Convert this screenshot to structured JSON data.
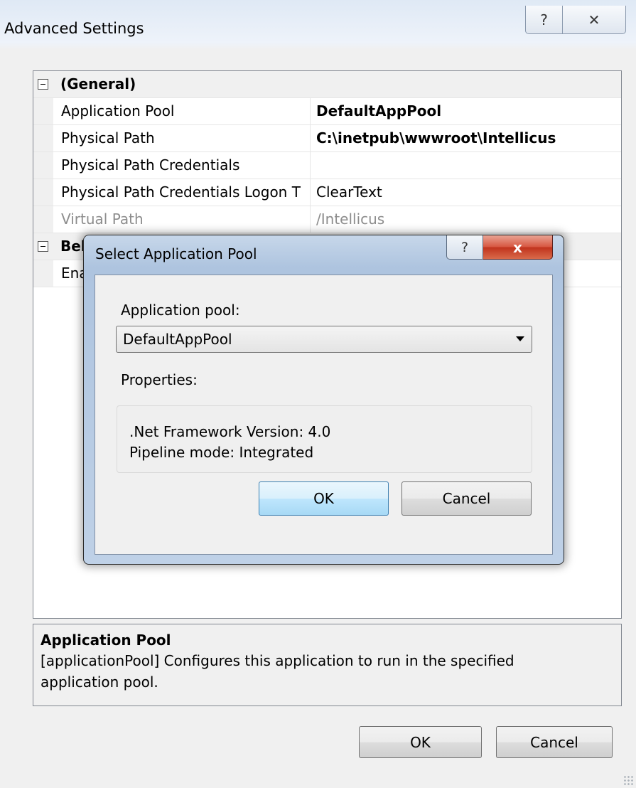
{
  "window": {
    "title": "Advanced Settings",
    "help_glyph": "?",
    "close_glyph": "✕"
  },
  "grid": {
    "general_category": "(General)",
    "behavior_category_partial": "Bel",
    "behavior_row_partial": "Ena",
    "rows": [
      {
        "label": "Application Pool",
        "value": "DefaultAppPool"
      },
      {
        "label": "Physical Path",
        "value": "C:\\inetpub\\wwwroot\\Intellicus"
      },
      {
        "label": "Physical Path Credentials",
        "value": ""
      },
      {
        "label": "Physical Path Credentials Logon T",
        "value": "ClearText"
      },
      {
        "label": "Virtual Path",
        "value": "/Intellicus"
      }
    ]
  },
  "description": {
    "title": "Application Pool",
    "text": "[applicationPool] Configures this application to run in the specified application pool."
  },
  "buttons": {
    "ok": "OK",
    "cancel": "Cancel"
  },
  "dialog": {
    "title": "Select Application Pool",
    "help_glyph": "?",
    "close_glyph": "x",
    "pool_label": "Application pool:",
    "pool_selected": "DefaultAppPool",
    "properties_label": "Properties:",
    "framework_line": ".Net Framework Version: 4.0",
    "pipeline_line": "Pipeline mode: Integrated",
    "ok": "OK",
    "cancel": "Cancel"
  }
}
